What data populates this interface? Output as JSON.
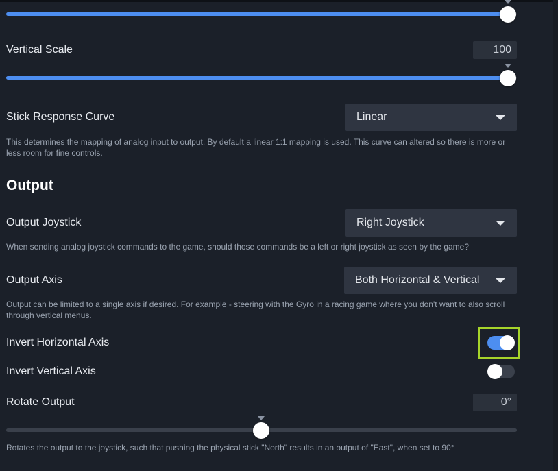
{
  "colors": {
    "background": "#1b2029",
    "accent": "#4d8ef0",
    "highlight": "#a6d42a"
  },
  "horizontal_scale_slider": {
    "value_fraction": 1.0
  },
  "vertical_scale": {
    "label": "Vertical Scale",
    "value": "100",
    "value_fraction": 1.0
  },
  "stick_response_curve": {
    "label": "Stick Response Curve",
    "selected": "Linear",
    "description": "This determines the mapping of analog input to output. By default a linear 1:1 mapping is used. This curve can altered so there is more or less room for fine controls."
  },
  "output_section": {
    "heading": "Output",
    "output_joystick": {
      "label": "Output Joystick",
      "selected": "Right Joystick",
      "description": "When sending analog joystick commands to the game, should those commands be a left or right joystick as seen by the game?"
    },
    "output_axis": {
      "label": "Output Axis",
      "selected": "Both Horizontal & Vertical",
      "description": "Output can be limited to a single axis if desired. For example - steering with the Gyro in a racing game where you don't want to also scroll through vertical menus."
    },
    "invert_horizontal": {
      "label": "Invert Horizontal Axis",
      "on": true
    },
    "invert_vertical": {
      "label": "Invert Vertical Axis",
      "on": false
    },
    "rotate_output": {
      "label": "Rotate Output",
      "value": "0°",
      "value_fraction": 0.5,
      "description": "Rotates the output to the joystick, such that pushing the physical stick \"North\" results in an output of \"East\", when set to 90°"
    }
  }
}
